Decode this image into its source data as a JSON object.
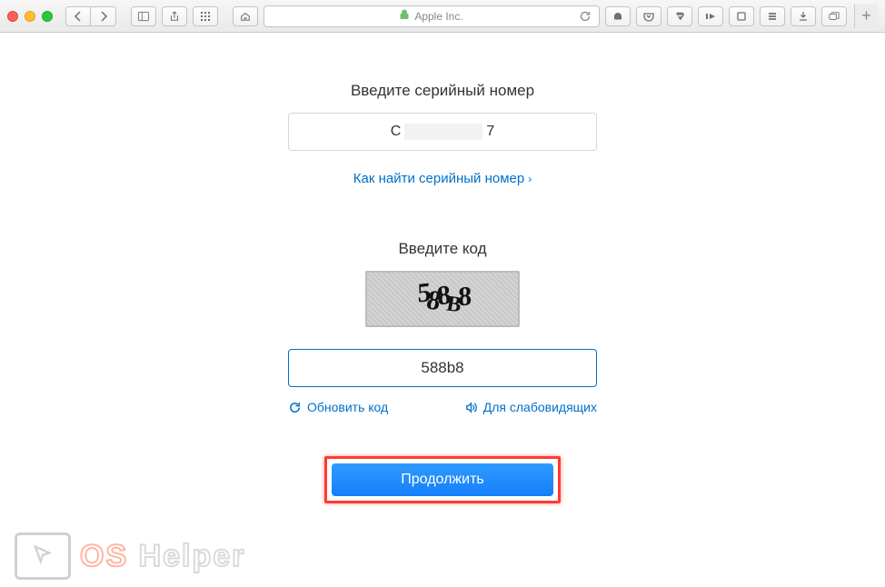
{
  "toolbar": {
    "address_label": "Apple Inc."
  },
  "page": {
    "serial": {
      "label": "Введите серийный номер",
      "value_prefix": "C",
      "value_suffix": "7",
      "help_link": "Как найти серийный номер"
    },
    "captcha": {
      "label": "Введите код",
      "image_text": "588B8",
      "input_value": "588b8",
      "refresh_label": "Обновить код",
      "accessibility_label": "Для слабовидящих"
    },
    "continue_label": "Продолжить"
  },
  "watermark": {
    "brand_part1": "OS",
    "brand_part2": " Helper"
  }
}
